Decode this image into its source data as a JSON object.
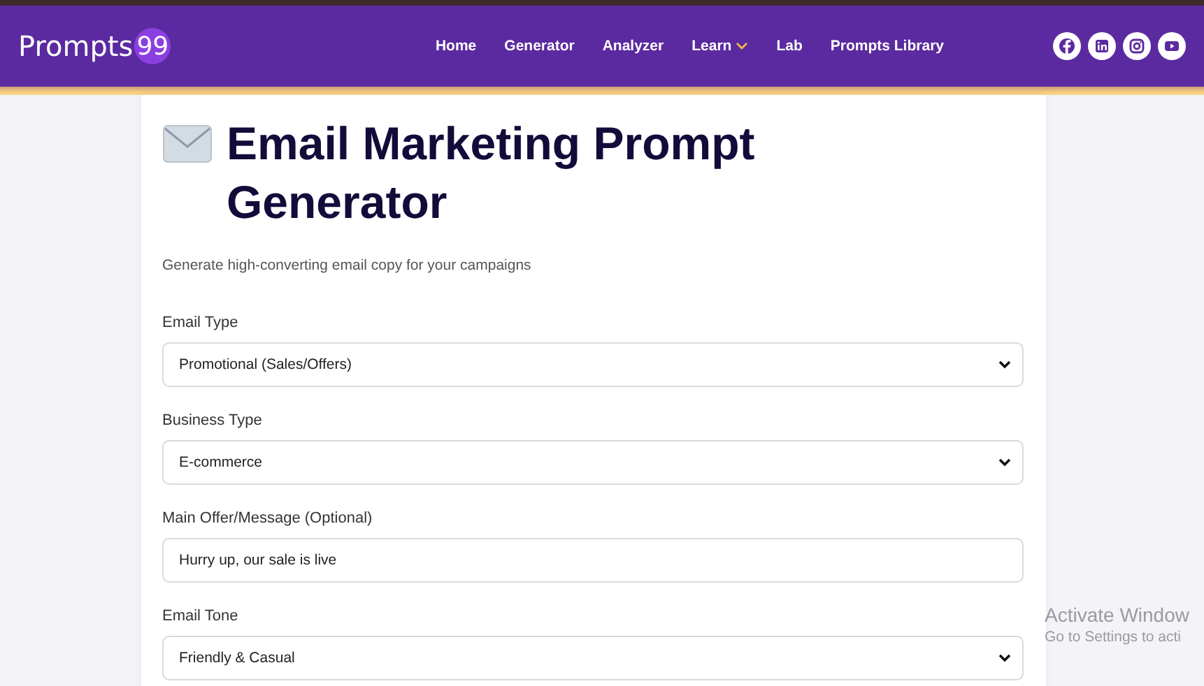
{
  "header": {
    "logo": {
      "text": "Prompts",
      "badge": "99"
    },
    "nav": [
      {
        "label": "Home",
        "dropdown": false
      },
      {
        "label": "Generator",
        "dropdown": false
      },
      {
        "label": "Analyzer",
        "dropdown": false
      },
      {
        "label": "Learn",
        "dropdown": true
      },
      {
        "label": "Lab",
        "dropdown": false
      },
      {
        "label": "Prompts Library",
        "dropdown": false
      }
    ],
    "social": [
      {
        "kind": "facebook"
      },
      {
        "kind": "linkedin"
      },
      {
        "kind": "instagram"
      },
      {
        "kind": "youtube"
      }
    ]
  },
  "card": {
    "title": "Email Marketing Prompt Generator",
    "subtitle": "Generate high-converting email copy for your campaigns",
    "fields": [
      {
        "kind": "select",
        "label": "Email Type",
        "value": "Promotional (Sales/Offers)"
      },
      {
        "kind": "select",
        "label": "Business Type",
        "value": "E-commerce"
      },
      {
        "kind": "text",
        "label": "Main Offer/Message (Optional)",
        "value": "Hurry up, our sale is live"
      },
      {
        "kind": "select",
        "label": "Email Tone",
        "value": "Friendly & Casual"
      }
    ]
  },
  "os_notice": {
    "title": "Activate Window",
    "text": "Go to Settings to acti"
  }
}
